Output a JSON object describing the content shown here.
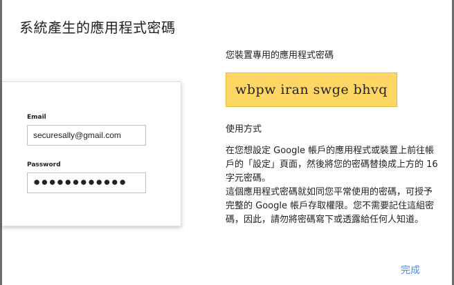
{
  "dialog": {
    "title": "系統產生的應用程式密碼",
    "done_label": "完成"
  },
  "illustration": {
    "email_label": "Email",
    "email_value": "securesally@gmail.com",
    "password_label": "Password",
    "password_value": "●●●●●●●●●●●●"
  },
  "app_password": {
    "label": "您裝置專用的應用程式密碼",
    "value": "wbpw iran swge bhvq",
    "box_color": "#fdd663"
  },
  "instructions": {
    "heading": "使用方式",
    "paragraph1": "在您想設定 Google 帳戶的應用程式或裝置上前往帳戶的「設定」頁面，然後將您的密碼替換成上方的 16 字元密碼。",
    "paragraph2": "這個應用程式密碼就如同您平常使用的密碼，可授予完整的 Google 帳戶存取權限。您不需要記住這組密碼，因此，請勿將密碼寫下或透露給任何人知道。"
  },
  "colors": {
    "link": "#4a8df5",
    "backdrop": "#6e6e6e"
  }
}
